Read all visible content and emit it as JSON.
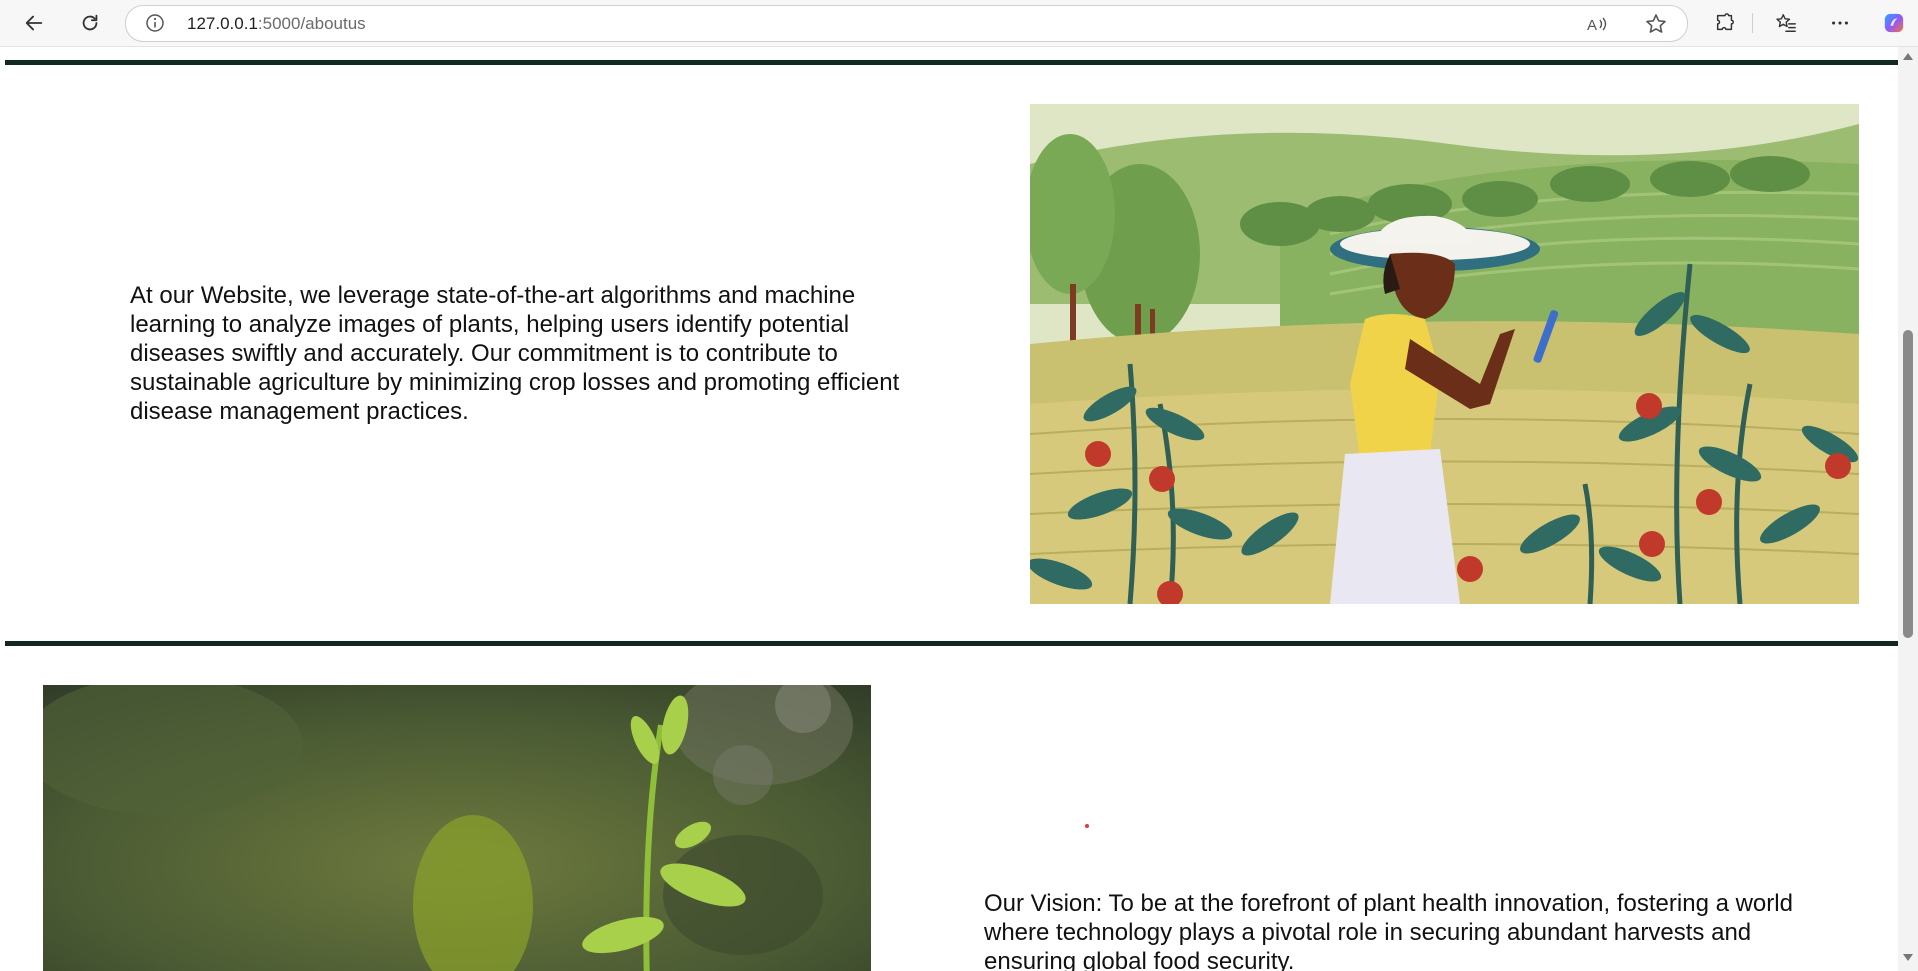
{
  "browser": {
    "url_host": "127.0.0.1",
    "url_rest": ":5000/aboutus",
    "icons": {
      "back": "back-arrow-icon",
      "reload": "reload-icon",
      "site_info": "info-icon",
      "read_aloud": "read-aloud-icon",
      "favorite": "star-icon",
      "extensions": "puzzle-icon",
      "favorites": "favorites-list-icon",
      "menu": "more-icon",
      "copilot": "copilot-icon"
    }
  },
  "page": {
    "about_text": "At our Website, we leverage state-of-the-art algorithms and machine learning to analyze images of plants, helping users identify potential diseases swiftly and accurately. Our commitment is to contribute to sustainable agriculture by minimizing crop losses and promoting efficient disease management practices.",
    "vision_text": "Our Vision: To be at the forefront of plant health innovation, fostering a world where technology plays a pivotal role in securing abundant harvests and ensuring global food security.",
    "colors": {
      "rule": "#12291f",
      "accent_dot": "#e53935"
    }
  }
}
